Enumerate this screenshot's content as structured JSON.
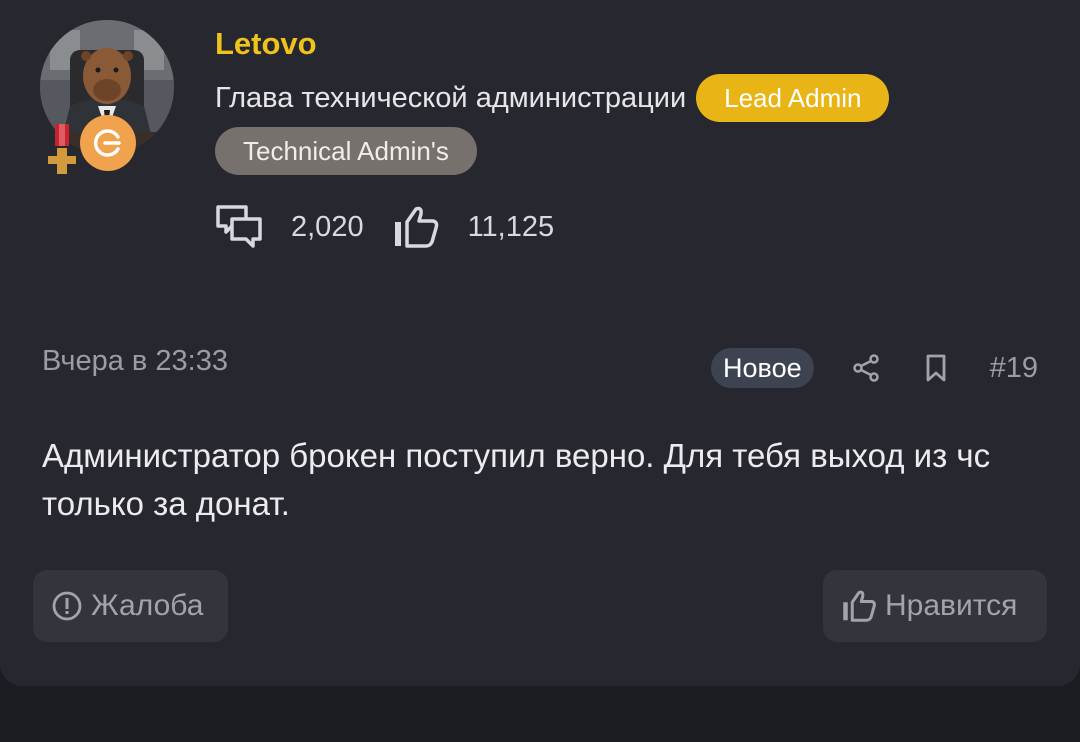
{
  "author": {
    "username": "Letovo",
    "user_title": "Глава технической администрации",
    "badges": {
      "lead": "Lead Admin",
      "tech": "Technical Admin's"
    },
    "stats": {
      "messages": "2,020",
      "reactions": "11,125"
    },
    "icons": [
      "avatar-capybara",
      "medal-icon",
      "rank-g-icon",
      "comments-icon",
      "thumbs-up-icon"
    ]
  },
  "post": {
    "date": "Вчера в 23:33",
    "new_label": "Новое",
    "number": "#19",
    "message": "Администратор брокен поступил верно. Для тебя выход из чс только за донат."
  },
  "actions": {
    "report_label": "Жалоба",
    "like_label": "Нравится"
  },
  "colors": {
    "username": "#f0c21e",
    "lead_badge": "#e9b516",
    "tech_badge": "#76716d",
    "rank_badge": "#f1a24c",
    "card_bg": "#27282f"
  }
}
